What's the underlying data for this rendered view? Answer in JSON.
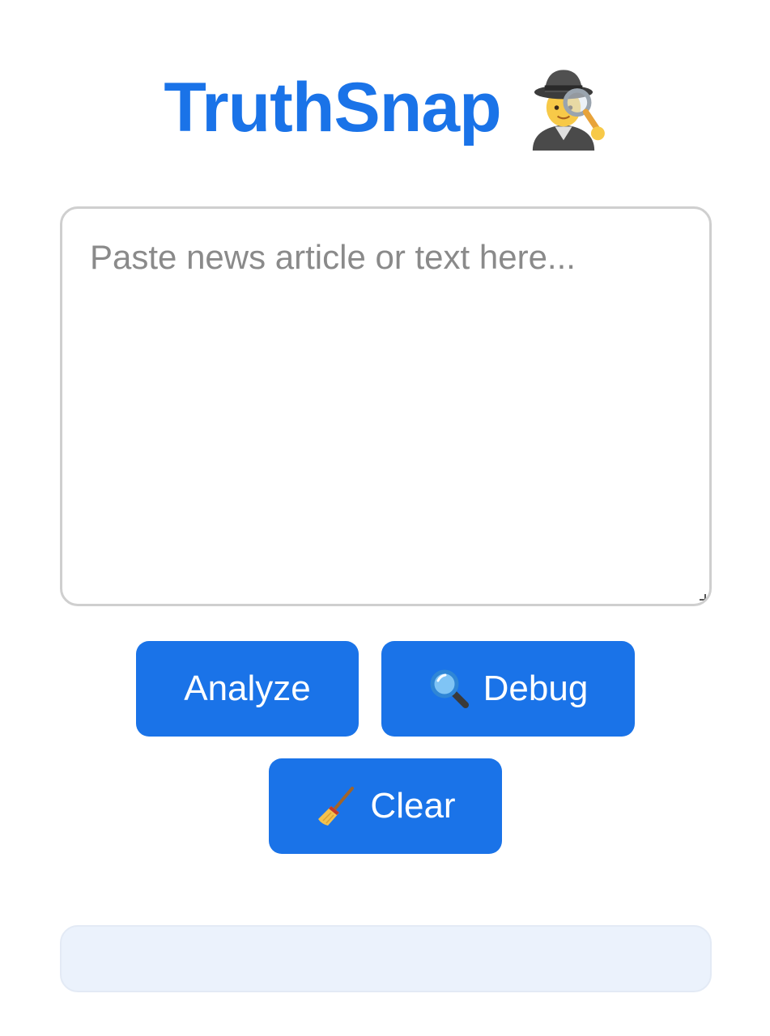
{
  "header": {
    "title": "TruthSnap",
    "title_icon": "detective-icon"
  },
  "input": {
    "placeholder": "Paste news article or text here...",
    "value": ""
  },
  "buttons": {
    "analyze_label": "Analyze",
    "debug_label": "Debug",
    "debug_icon": "magnifying-glass-icon",
    "clear_label": "Clear",
    "clear_icon": "broom-icon"
  },
  "result": {
    "text": ""
  },
  "colors": {
    "accent": "#1a73e8",
    "result_background": "#ebf2fc",
    "input_border": "#cfcfcf"
  }
}
